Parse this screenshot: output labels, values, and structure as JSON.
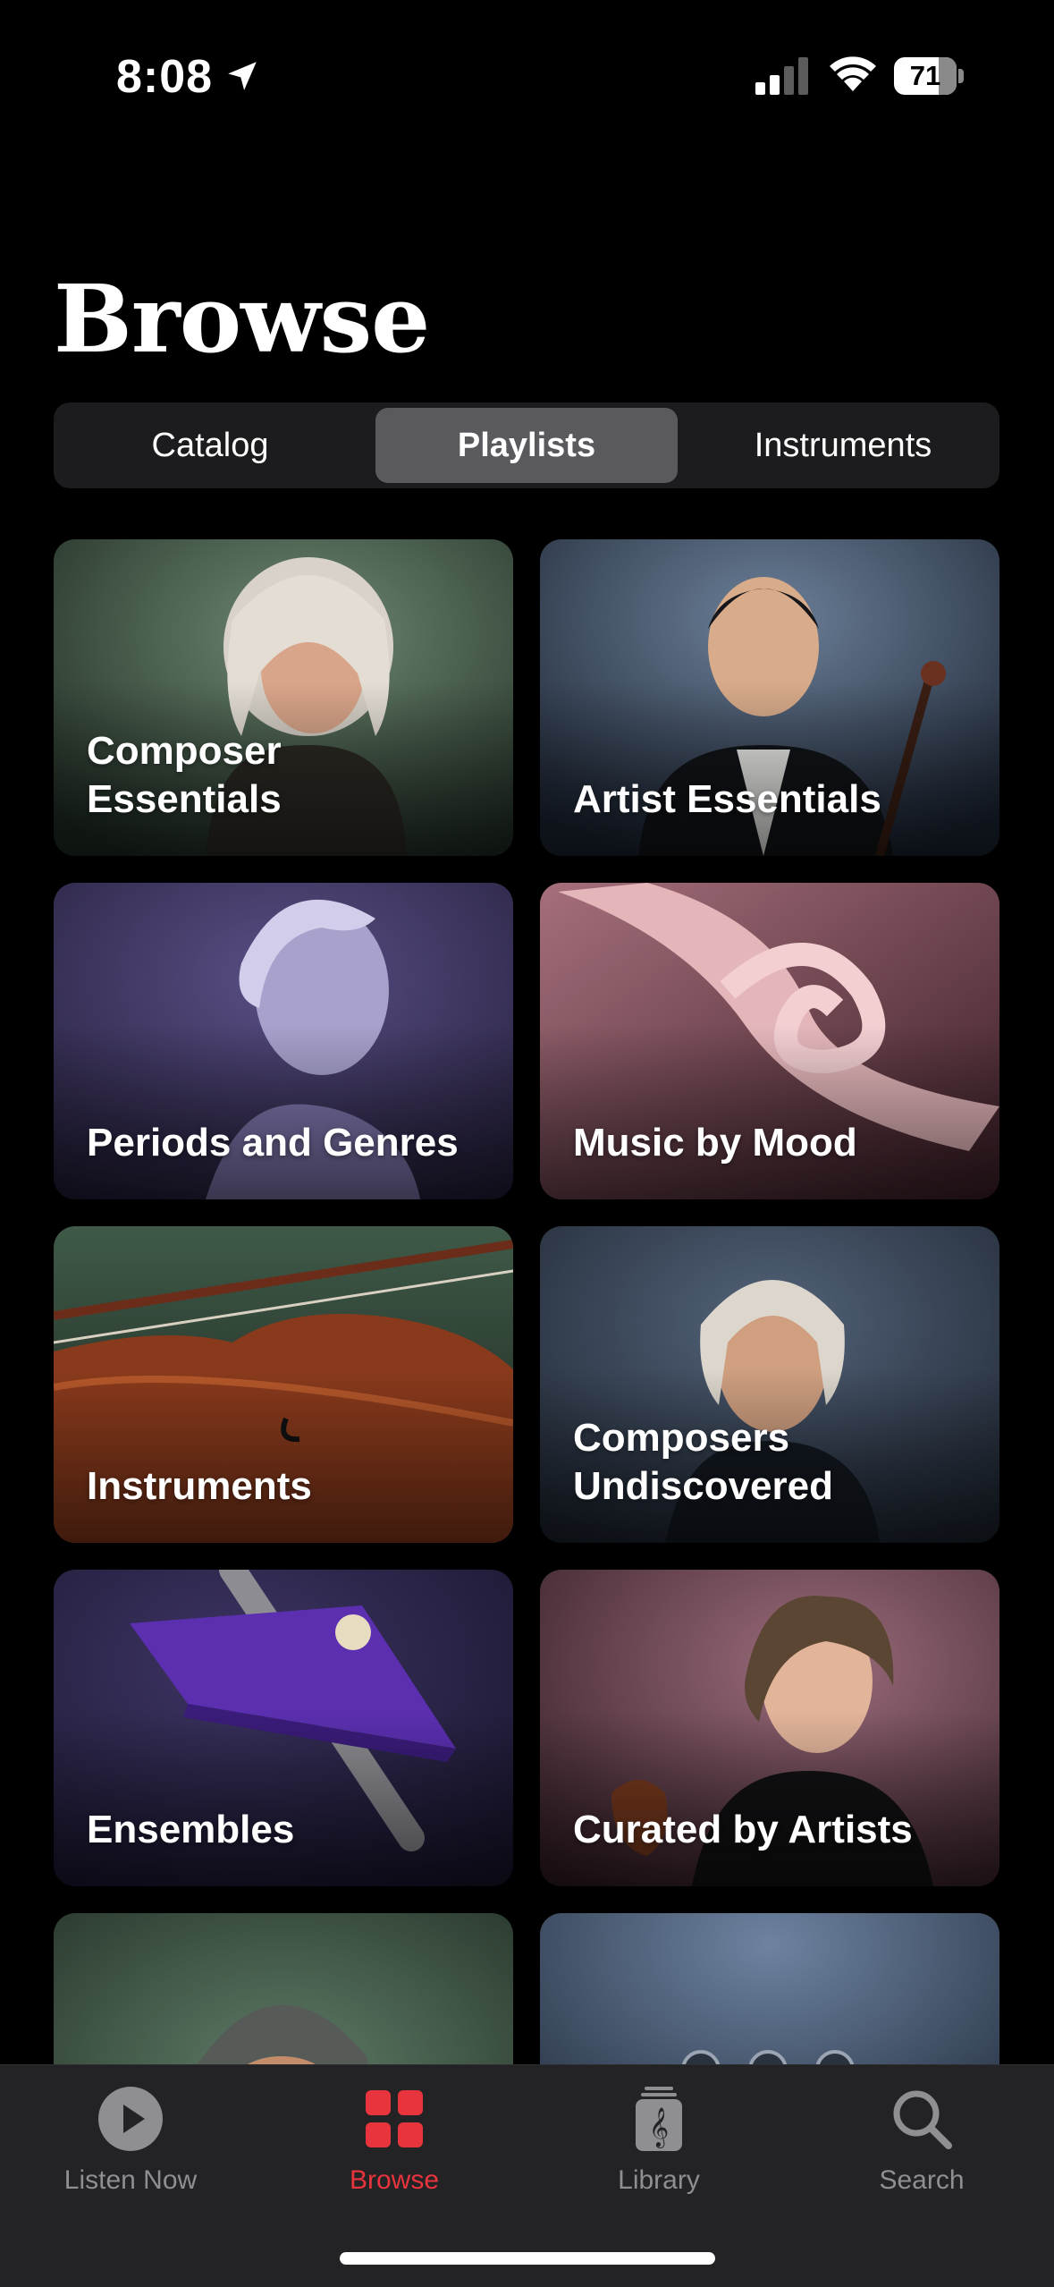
{
  "status_bar": {
    "time": "8:08",
    "battery_percent": 71,
    "battery_label": "71",
    "location_icon": "location-arrow-icon",
    "signal_icon": "cellular-signal-icon",
    "wifi_icon": "wifi-icon"
  },
  "page": {
    "title": "Browse"
  },
  "segmented_control": {
    "items": [
      {
        "label": "Catalog",
        "selected": false
      },
      {
        "label": "Playlists",
        "selected": true
      },
      {
        "label": "Instruments",
        "selected": false
      }
    ]
  },
  "tiles": [
    {
      "label": "Composer\nEssentials",
      "art": "baroque-composer-portrait"
    },
    {
      "label": "Artist Essentials",
      "art": "cellist-portrait"
    },
    {
      "label": "Periods and Genres",
      "art": "classical-marble-bust"
    },
    {
      "label": "Music by Mood",
      "art": "pink-silk-ribbon"
    },
    {
      "label": "Instruments",
      "art": "violin-closeup"
    },
    {
      "label": "Composers\nUndiscovered",
      "art": "classical-composer-portrait"
    },
    {
      "label": "Ensembles",
      "art": "purple-conductor-baton"
    },
    {
      "label": "Curated by Artists",
      "art": "violinist-portrait"
    },
    {
      "label": "",
      "art": "beethoven-portrait"
    },
    {
      "label": "",
      "art": "blue-instrument-keys"
    }
  ],
  "colors": {
    "accent": "#e8343c",
    "tab_inactive": "#8e8e93",
    "segment_selected": "#5a5a5e",
    "segment_background": "#1c1c1e"
  },
  "tab_bar": {
    "items": [
      {
        "label": "Listen Now",
        "icon": "play-circle-icon",
        "active": false
      },
      {
        "label": "Browse",
        "icon": "grid-icon",
        "active": true
      },
      {
        "label": "Library",
        "icon": "library-icon",
        "active": false
      },
      {
        "label": "Search",
        "icon": "search-icon",
        "active": false
      }
    ]
  }
}
